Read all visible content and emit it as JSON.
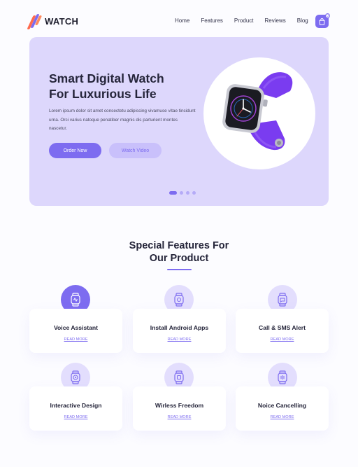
{
  "brand": {
    "name": "WATCH"
  },
  "nav": {
    "items": [
      "Home",
      "Features",
      "Product",
      "Reviews",
      "Blog"
    ]
  },
  "cart": {
    "count": "0",
    "icon": "shopping-bag-icon"
  },
  "hero": {
    "title_line1": "Smart Digital Watch",
    "title_line2": "For Luxurious Life",
    "description": "Lorem ipsum dolor sit amet consectetu adipiscing vivamuse vitae tincidunt urna. Orci varius natoque penatiber magnis dis parturient montes nascetur.",
    "primary_button": "Order Now",
    "secondary_button": "Watch Video",
    "slides_total": 4,
    "slide_active": 1
  },
  "features": {
    "title_line1": "Special Features For",
    "title_line2": "Our Product",
    "items": [
      {
        "title": "Voice Assistant",
        "link": "READ MORE",
        "highlighted": true
      },
      {
        "title": "Install Android Apps",
        "link": "READ MORE",
        "highlighted": false
      },
      {
        "title": "Call & SMS Alert",
        "link": "READ MORE",
        "highlighted": false
      },
      {
        "title": "Interactive Design",
        "link": "READ MORE",
        "highlighted": false
      },
      {
        "title": "Wirless Freedom",
        "link": "READ MORE",
        "highlighted": false
      },
      {
        "title": "Noice Cancelling",
        "link": "READ MORE",
        "highlighted": false
      }
    ]
  },
  "colors": {
    "accent": "#7d6cf0",
    "hero_bg": "#ddd7fc",
    "icon_bg": "#e3defd",
    "logo_colors": [
      "#ff6a4d",
      "#7d6cf0"
    ]
  }
}
